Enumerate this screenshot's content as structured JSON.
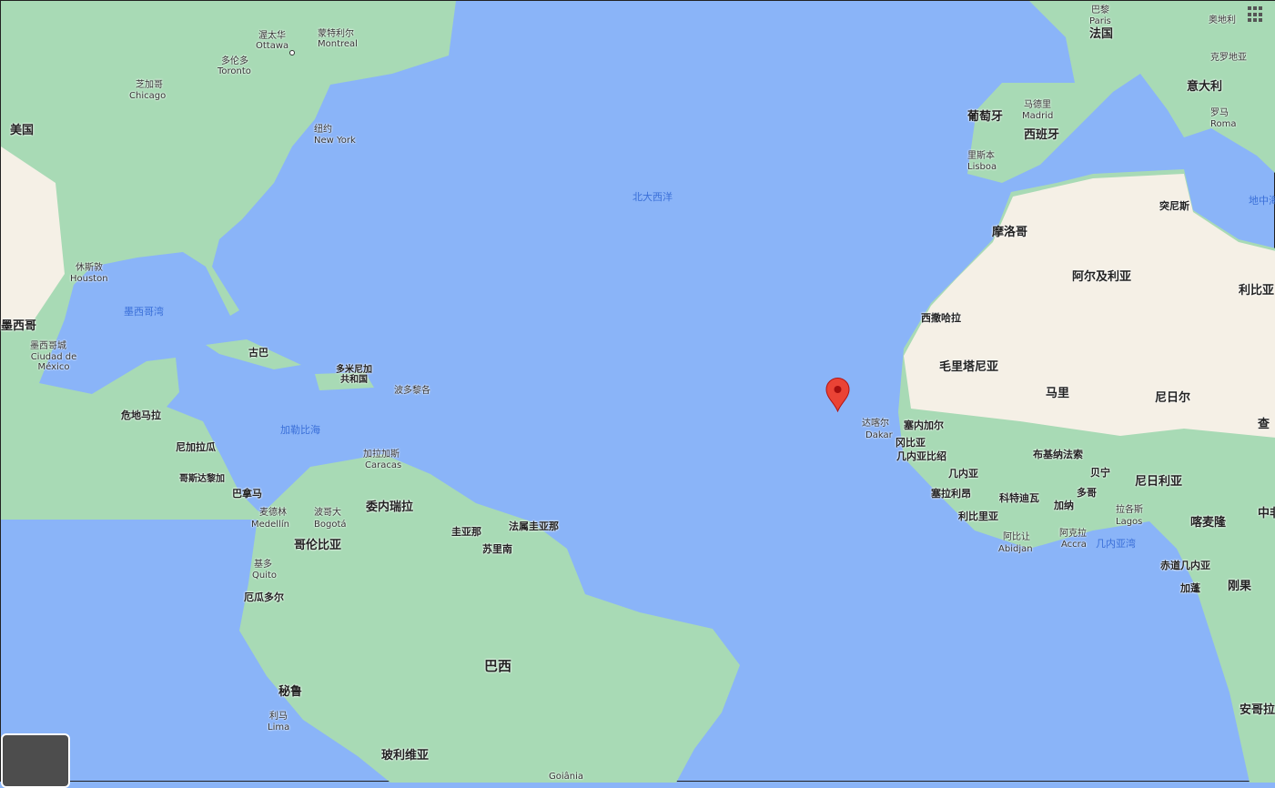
{
  "colors": {
    "ocean": "#8ab4f8",
    "land": "#a8dab5",
    "desert": "#f5f0e6",
    "marker": "#ea4335"
  },
  "icons": {
    "apps": "grid-icon",
    "marker": "map-pin-icon"
  },
  "labels": {
    "usa": "美国",
    "canada_ottawa": "渥太华",
    "ottawa": "Ottawa",
    "montreal_cn": "蒙特利尔",
    "montreal": "Montreal",
    "toronto_cn": "多伦多",
    "toronto": "Toronto",
    "chicago_cn": "芝加哥",
    "chicago": "Chicago",
    "newyork_cn": "纽约",
    "newyork": "New York",
    "houston_cn": "休斯敦",
    "houston": "Houston",
    "gulf": "墨西哥湾",
    "mexico": "墨西哥",
    "mexicocity_cn": "墨西哥城",
    "mexicocity": "Ciudad de México",
    "cuba": "古巴",
    "dominican": "多米尼加\n共和国",
    "puertorico": "波多黎各",
    "guatemala": "危地马拉",
    "nicaragua": "尼加拉瓜",
    "costarica": "哥斯达黎加",
    "panama": "巴拿马",
    "caribbean": "加勒比海",
    "caracas_cn": "加拉加斯",
    "caracas": "Caracas",
    "venezuela": "委内瑞拉",
    "guyana": "圭亚那",
    "suriname": "苏里南",
    "frguiana": "法属圭亚那",
    "medellin_cn": "麦德林",
    "medellin": "Medellín",
    "bogota_cn": "波哥大",
    "bogota": "Bogotá",
    "colombia": "哥伦比亚",
    "quito_cn": "基多",
    "quito": "Quito",
    "ecuador": "厄瓜多尔",
    "brazil": "巴西",
    "peru": "秘鲁",
    "lima_cn": "利马",
    "lima": "Lima",
    "bolivia": "玻利维亚",
    "goiania": "Goiânia",
    "atlantic": "北大西洋",
    "paris_cn": "巴黎",
    "paris": "Paris",
    "france": "法国",
    "austria": "奥地利",
    "croatia": "克罗地亚",
    "italy": "意大利",
    "rome_cn": "罗马",
    "rome": "Roma",
    "portugal": "葡萄牙",
    "spain": "西班牙",
    "madrid_cn": "马德里",
    "madrid": "Madrid",
    "lisbon_cn": "里斯本",
    "lisbon": "Lisboa",
    "tunisia": "突尼斯",
    "med": "地中海",
    "morocco": "摩洛哥",
    "algeria": "阿尔及利亚",
    "libya": "利比亚",
    "wsahara": "西撒哈拉",
    "mauritania": "毛里塔尼亚",
    "mali": "马里",
    "niger": "尼日尔",
    "chad": "查",
    "dakar_cn": "达喀尔",
    "dakar": "Dakar",
    "senegal": "塞内加尔",
    "gambia": "冈比亚",
    "guineabissau": "几内亚比绍",
    "guinea": "几内亚",
    "burkina": "布基纳法索",
    "sierraleone": "塞拉利昂",
    "ivorycoast": "科特迪瓦",
    "benin": "贝宁",
    "togo": "多哥",
    "ghana": "加纳",
    "nigeria": "尼日利亚",
    "liberia": "利比里亚",
    "abidjan_cn": "阿比让",
    "abidjan": "Abidjan",
    "accra_cn": "阿克拉",
    "accra": "Accra",
    "lagos_cn": "拉各斯",
    "lagos": "Lagos",
    "gulfguinea": "几内亚湾",
    "cameroon": "喀麦隆",
    "eqguinea": "赤道几内亚",
    "gabon": "加蓬",
    "congo": "刚果",
    "angola": "安哥拉",
    "ne": "中非"
  }
}
